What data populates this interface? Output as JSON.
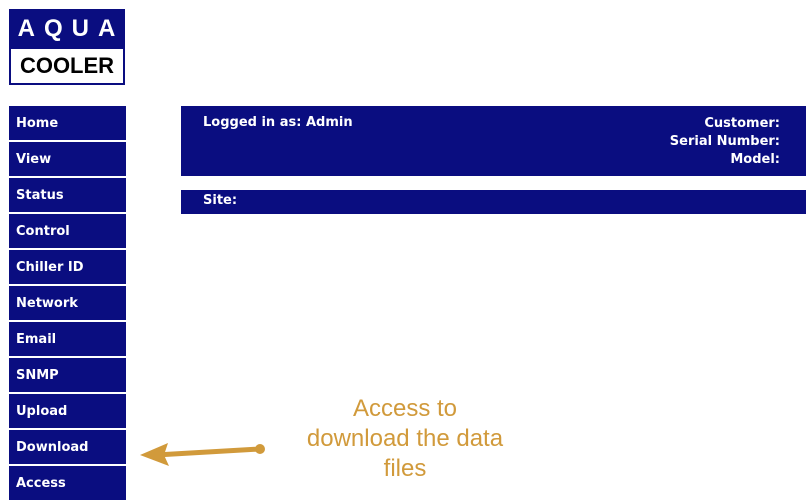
{
  "logo": {
    "top": "AQUA",
    "bottom": "COOLER"
  },
  "nav": {
    "items": [
      {
        "label": "Home"
      },
      {
        "label": "View"
      },
      {
        "label": "Status"
      },
      {
        "label": "Control"
      },
      {
        "label": "Chiller ID"
      },
      {
        "label": "Network"
      },
      {
        "label": "Email"
      },
      {
        "label": "SNMP"
      },
      {
        "label": "Upload"
      },
      {
        "label": "Download"
      },
      {
        "label": "Access"
      }
    ]
  },
  "header": {
    "logged_in_label": "Logged in as:  Admin",
    "customer_label": "Customer:",
    "serial_label": "Serial Number:",
    "model_label": "Model:"
  },
  "site": {
    "label": "Site:"
  },
  "annotation": {
    "lines": [
      "Access to",
      "download the data",
      "files"
    ],
    "color": "#d19a3b"
  },
  "colors": {
    "primary": "#0a0d80",
    "text_light": "#ffffff",
    "annotation": "#d19a3b"
  }
}
